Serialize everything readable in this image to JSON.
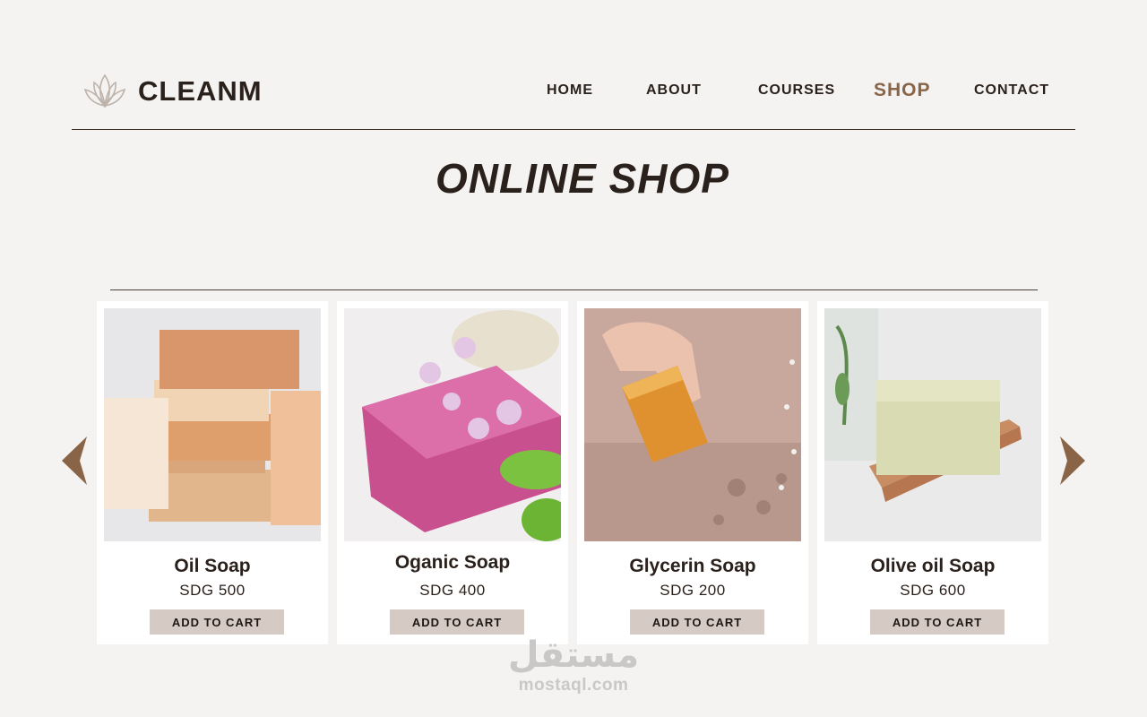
{
  "brand": {
    "name": "CLEANM",
    "logo_icon": "lotus-icon"
  },
  "nav": {
    "items": [
      {
        "label": "HOME",
        "active": false
      },
      {
        "label": "ABOUT",
        "active": false
      },
      {
        "label": "COURSES",
        "active": false
      },
      {
        "label": "SHOP",
        "active": true
      },
      {
        "label": "CONTACT",
        "active": false
      }
    ]
  },
  "page": {
    "title": "ONLINE SHOP"
  },
  "carousel": {
    "prev_icon": "chevron-left-icon",
    "next_icon": "chevron-right-icon",
    "products": [
      {
        "name": "Oil Soap",
        "price": "SDG 500",
        "button": "ADD TO CART",
        "image": "stacked-soap-bars-image"
      },
      {
        "name": "Oganic Soap",
        "price": "SDG 400",
        "button": "ADD TO CART",
        "image": "pink-soap-with-flowers-image"
      },
      {
        "name": "Glycerin Soap",
        "price": "SDG 200",
        "button": "ADD TO CART",
        "image": "hand-holding-glycerin-soap-image"
      },
      {
        "name": "Olive oil Soap",
        "price": "SDG 600",
        "button": "ADD TO CART",
        "image": "olive-soap-on-wooden-dish-image"
      }
    ]
  },
  "watermark": {
    "arabic": "مستقل",
    "latin": "mostaql.com"
  },
  "colors": {
    "background": "#f4f3f1",
    "accent": "#8a6446",
    "text": "#2b211c",
    "button": "#d5cbc4"
  }
}
